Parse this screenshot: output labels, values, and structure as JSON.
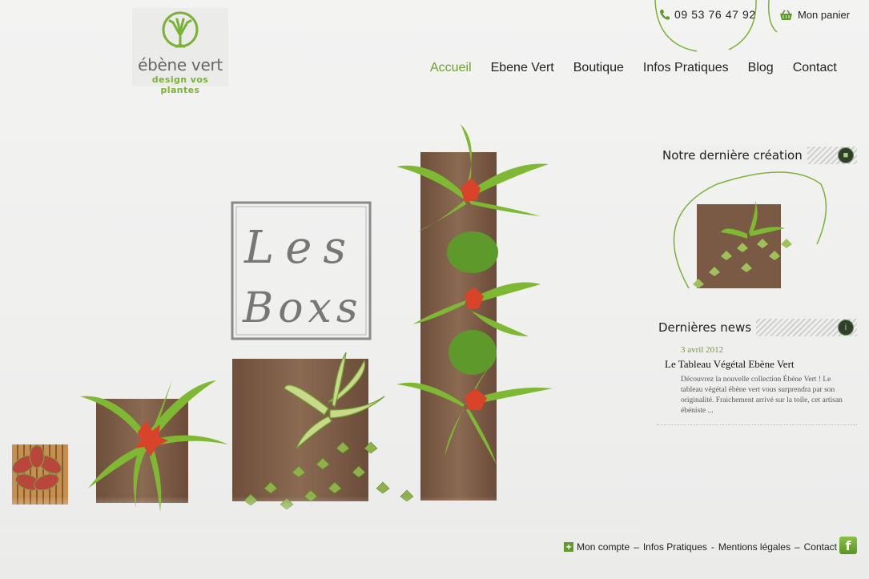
{
  "logo": {
    "name": "ébène vert",
    "tagline": "design vos plantes"
  },
  "header": {
    "phone": "09 53 76 47 92",
    "cart": "Mon panier"
  },
  "nav": {
    "items": [
      {
        "label": "Accueil"
      },
      {
        "label": "Ebene Vert"
      },
      {
        "label": "Boutique"
      },
      {
        "label": "Infos Pratiques"
      },
      {
        "label": "Blog"
      },
      {
        "label": "Contact"
      }
    ],
    "active_index": 0
  },
  "hero": {
    "sign_line1": "Les",
    "sign_line2": "Boxs"
  },
  "sidebar": {
    "creation_title": "Notre dernière création",
    "news_title": "Dernières news",
    "news": {
      "date": "3 avril 2012",
      "title": "Le Tableau Végétal Ebène Vert",
      "excerpt": "Découvrez la nouvelle collection Ébène Vert ! Le tableau végétal ébène vert vous surprendra par son originalité. Fraichement arrivé sur la toile, cet artisan ébéniste ..."
    }
  },
  "footer": {
    "links": [
      "Mon compte",
      "Infos Pratiques",
      "Mentions légales",
      "Contact"
    ],
    "separators": [
      "–",
      "-",
      "–"
    ],
    "facebook": "f"
  },
  "colors": {
    "accent": "#6c9f2e",
    "text": "#222222",
    "wood": "#7a5a44",
    "leaf": "#7fb832",
    "flower": "#d8432a"
  }
}
